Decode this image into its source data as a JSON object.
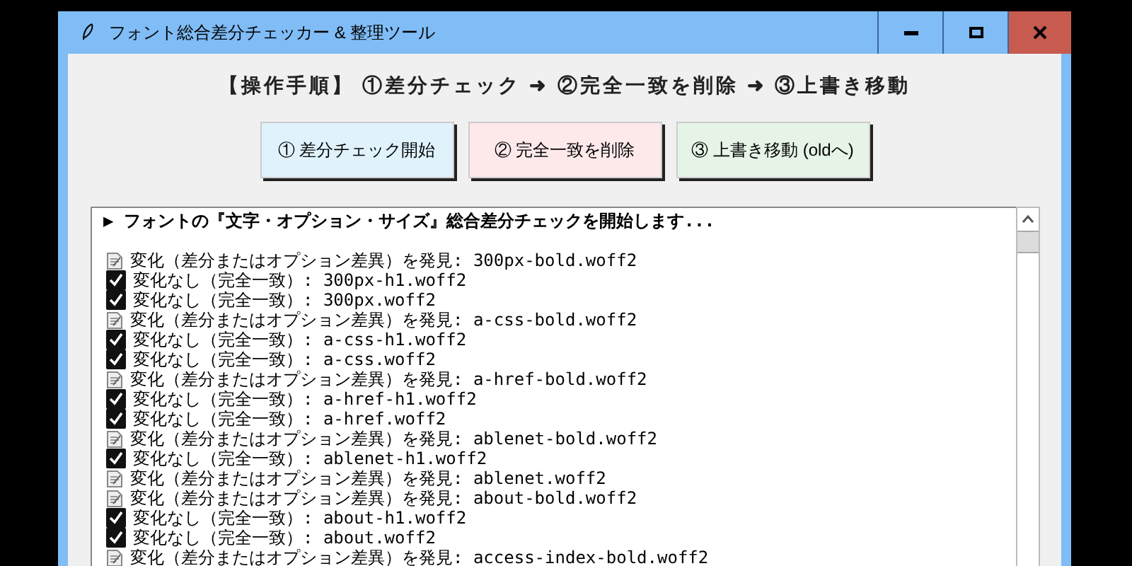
{
  "window": {
    "title": "フォント総合差分チェッカー & 整理ツール"
  },
  "instructions": "【操作手順】 ①差分チェック ➜ ②完全一致を削除 ➜ ③上書き移動",
  "buttons": [
    {
      "label": "① 差分チェック開始",
      "color": "#e0f2fc"
    },
    {
      "label": "② 完全一致を削除",
      "color": "#fde8ea"
    },
    {
      "label": "③ 上書き移動 (oldへ)",
      "color": "#e6f4e7"
    }
  ],
  "log": {
    "header": "▶ フォントの『文字・オプション・サイズ』総合差分チェックを開始します...",
    "lines": [
      {
        "kind": "changed",
        "text": "変化（差分またはオプション差異）を発見: 300px-bold.woff2"
      },
      {
        "kind": "same",
        "text": "変化なし（完全一致）: 300px-h1.woff2"
      },
      {
        "kind": "same",
        "text": "変化なし（完全一致）: 300px.woff2"
      },
      {
        "kind": "changed",
        "text": "変化（差分またはオプション差異）を発見: a-css-bold.woff2"
      },
      {
        "kind": "same",
        "text": "変化なし（完全一致）: a-css-h1.woff2"
      },
      {
        "kind": "same",
        "text": "変化なし（完全一致）: a-css.woff2"
      },
      {
        "kind": "changed",
        "text": "変化（差分またはオプション差異）を発見: a-href-bold.woff2"
      },
      {
        "kind": "same",
        "text": "変化なし（完全一致）: a-href-h1.woff2"
      },
      {
        "kind": "same",
        "text": "変化なし（完全一致）: a-href.woff2"
      },
      {
        "kind": "changed",
        "text": "変化（差分またはオプション差異）を発見: ablenet-bold.woff2"
      },
      {
        "kind": "same",
        "text": "変化なし（完全一致）: ablenet-h1.woff2"
      },
      {
        "kind": "changed",
        "text": "変化（差分またはオプション差異）を発見: ablenet.woff2"
      },
      {
        "kind": "changed",
        "text": "変化（差分またはオプション差異）を発見: about-bold.woff2"
      },
      {
        "kind": "same",
        "text": "変化なし（完全一致）: about-h1.woff2"
      },
      {
        "kind": "same",
        "text": "変化なし（完全一致）: about.woff2"
      },
      {
        "kind": "changed",
        "text": "変化（差分またはオプション差異）を発見: access-index-bold.woff2"
      }
    ]
  }
}
